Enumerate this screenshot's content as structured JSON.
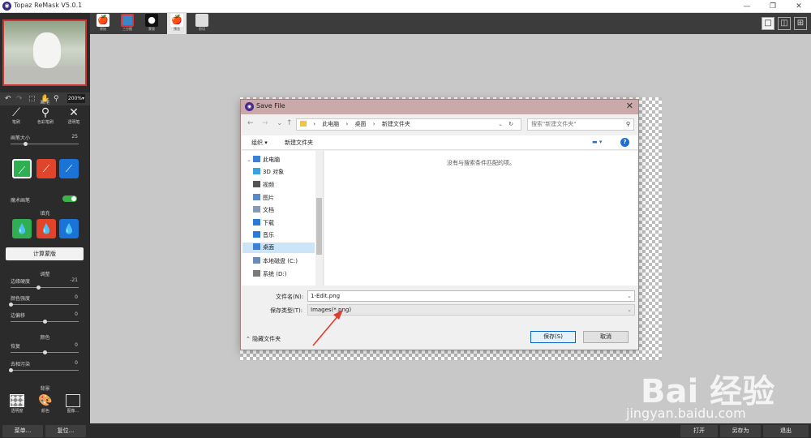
{
  "app": {
    "title": "Topaz ReMask V5.0.1",
    "logo_glyph": "◉"
  },
  "window_buttons": [
    "—",
    "❐",
    "✕"
  ],
  "left_panel": {
    "zoom": "200%▾",
    "brush_section": "画笔",
    "brushes": [
      "笔刷",
      "色彩笔刷",
      "透明笔"
    ],
    "brush_size_label": "画笔大小",
    "brush_size_value": "25",
    "brush_size_fraction": 0.22,
    "magic_brush_label": "魔术画笔",
    "fill_section": "填充",
    "calc_button": "计算蒙版",
    "adjust_section": "调整",
    "sliders": [
      {
        "label": "边缘硬度",
        "value": "-21",
        "fraction": 0.4
      },
      {
        "label": "颜色强度",
        "value": "0",
        "fraction": 0.0
      },
      {
        "label": "边偏移",
        "value": "0",
        "fraction": 0.5
      }
    ],
    "color_section": "颜色",
    "color_sliders": [
      {
        "label": "恢复",
        "value": "0",
        "fraction": 0.5
      },
      {
        "label": "去相污染",
        "value": "0",
        "fraction": 0.0
      }
    ],
    "bg_section": "背景",
    "bg_items": [
      "透明度",
      "颜色",
      "图像..."
    ]
  },
  "top_tabs": [
    {
      "label": "原始",
      "color": "#d43a3a"
    },
    {
      "label": "三分图",
      "color": "#3b86c6"
    },
    {
      "label": "蒙版",
      "color": "#111111"
    },
    {
      "label": "预览",
      "color": "#d43a3a"
    },
    {
      "label": "剪切",
      "color": "#dddddd"
    }
  ],
  "view_buttons": [
    "□",
    "◫",
    "⊞"
  ],
  "dialog": {
    "title": "Save File",
    "close": "✕",
    "path": [
      "此电脑",
      "桌面",
      "新建文件夹"
    ],
    "search_placeholder": "搜索\"新建文件夹\"",
    "organize": "组织 ▾",
    "new_folder": "新建文件夹",
    "empty_message": "没有与搜索条件匹配的项。",
    "nav_items": [
      {
        "label": "此电脑",
        "color": "#3b7fd6"
      },
      {
        "label": "3D 对象",
        "color": "#3aa0e0"
      },
      {
        "label": "视频",
        "color": "#555555"
      },
      {
        "label": "图片",
        "color": "#5a8ac6"
      },
      {
        "label": "文档",
        "color": "#8a9ab0"
      },
      {
        "label": "下载",
        "color": "#2a7ad6"
      },
      {
        "label": "音乐",
        "color": "#2a7ad6"
      },
      {
        "label": "桌面",
        "color": "#3b7fd6"
      },
      {
        "label": "本地磁盘 (C:)",
        "color": "#6a8ab8"
      },
      {
        "label": "系统 (D:)",
        "color": "#7a7a7a"
      }
    ],
    "filename_label": "文件名(N):",
    "filename_value": "1-Edit.png",
    "filetype_label": "保存类型(T):",
    "filetype_value": "Images(*.png)",
    "hide_folders": "隐藏文件夹",
    "save_button": "保存(S)",
    "cancel_button": "取消"
  },
  "bottom": {
    "menu": "菜单...",
    "reset": "复位...",
    "open": "打开",
    "save_as": "另存为",
    "exit": "退出"
  },
  "watermark": {
    "text": "Bai 经验",
    "url": "jingyan.baidu.com"
  }
}
